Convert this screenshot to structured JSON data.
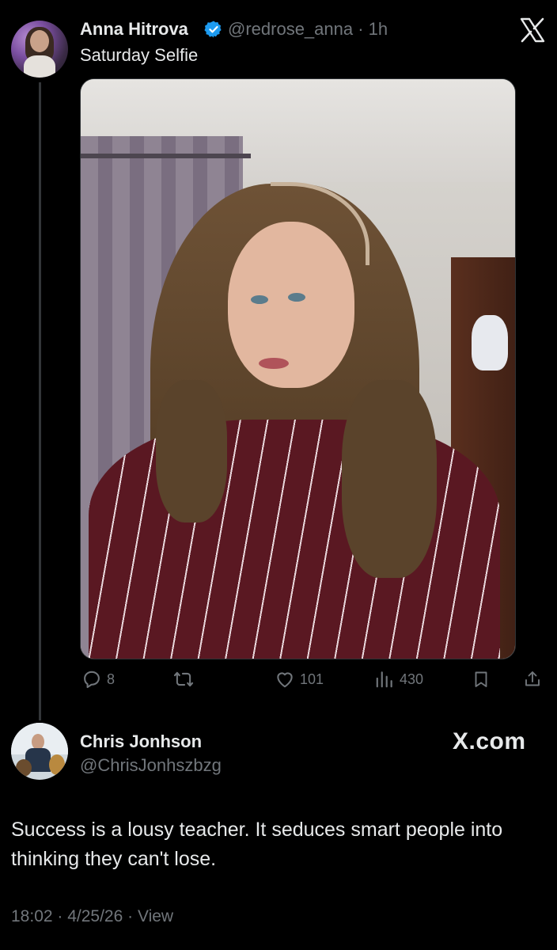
{
  "tweet": {
    "author_name": "Anna Hitrova",
    "handle_time": "@redrose_anna · 1h",
    "text": "Saturday Selfie",
    "verified_color": "#1d9bf0",
    "avatar_icon": "woman-avatar",
    "photo": "selfie-photo"
  },
  "actions": {
    "replies": "8",
    "reposts": "",
    "likes": "101",
    "views": "430"
  },
  "quote": {
    "author_name": "Chris Jonhson",
    "handle": "@ChrisJonhszbzg",
    "brand": "X.com",
    "text": "Success is a lousy teacher. It seduces smart people into thinking they can't lose.",
    "meta": "18:02 · 4/25/26 · View"
  },
  "colors": {
    "background": "#000000",
    "text": "#e7e9ea",
    "muted": "#71767b",
    "thread_line": "#333639"
  }
}
